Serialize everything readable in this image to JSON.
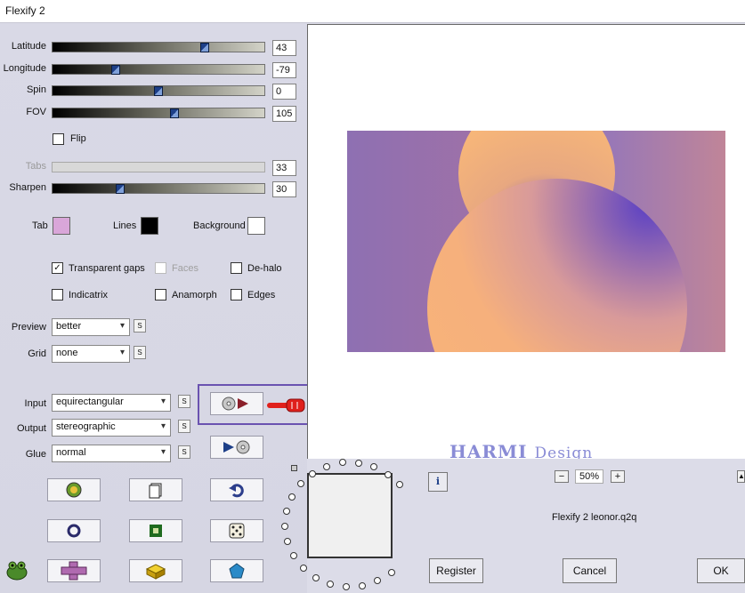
{
  "window": {
    "title": "Flexify 2"
  },
  "sliders": [
    {
      "label": "Latitude",
      "value": "43",
      "thumb_frac": 0.73,
      "disabled": false
    },
    {
      "label": "Longitude",
      "value": "-79",
      "thumb_frac": 0.29,
      "disabled": false
    },
    {
      "label": "Spin",
      "value": "0",
      "thumb_frac": 0.5,
      "disabled": false
    },
    {
      "label": "FOV",
      "value": "105",
      "thumb_frac": 0.58,
      "disabled": false
    },
    {
      "label": "Tabs",
      "value": "33",
      "thumb_frac": null,
      "disabled": true
    },
    {
      "label": "Sharpen",
      "value": "30",
      "thumb_frac": 0.31,
      "disabled": false
    }
  ],
  "flip": {
    "label": "Flip",
    "checked": false
  },
  "colors": {
    "tab_label": "Tab",
    "tab_color": "#d9a6d9",
    "lines_label": "Lines",
    "lines_color": "#000000",
    "background_label": "Background",
    "background_color": "#ffffff"
  },
  "options": {
    "transparent_gaps": {
      "label": "Transparent gaps",
      "checked": true
    },
    "faces": {
      "label": "Faces",
      "checked": false
    },
    "dehalo": {
      "label": "De-halo",
      "checked": false
    },
    "indicatrix": {
      "label": "Indicatrix",
      "checked": false
    },
    "anamorph": {
      "label": "Anamorph",
      "checked": false
    },
    "edges": {
      "label": "Edges",
      "checked": false
    }
  },
  "preview_select": {
    "label": "Preview",
    "value": "better"
  },
  "grid_select": {
    "label": "Grid",
    "value": "none"
  },
  "input_select": {
    "label": "Input",
    "value": "equirectangular"
  },
  "output_select": {
    "label": "Output",
    "value": "stereographic"
  },
  "glue_select": {
    "label": "Glue",
    "value": "normal"
  },
  "s_label": "S",
  "zoom": {
    "value": "50%",
    "minus": "−",
    "plus": "+"
  },
  "preset_name": "Flexify 2 leonor.q2q",
  "buttons": {
    "register": "Register",
    "cancel": "Cancel",
    "ok": "OK"
  },
  "watermark": {
    "main": "HARMI",
    "sub": "Design"
  },
  "info_label": "i",
  "icons": [
    "globe-icon",
    "page-icon",
    "undo-icon",
    "ring-icon",
    "square-icon",
    "dice-icon",
    "cross-icon",
    "brick-icon",
    "gem-icon",
    "disk-play-icon",
    "play-disk-icon",
    "frog-logo-icon",
    "pointing-hand-icon"
  ]
}
